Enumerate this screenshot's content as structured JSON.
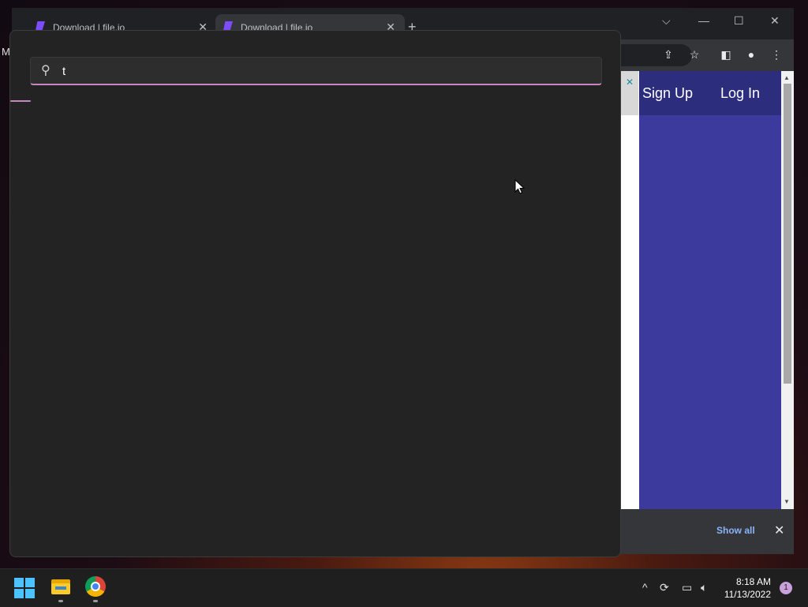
{
  "desktop": {
    "edge_text": "M"
  },
  "browser": {
    "tabs": [
      {
        "title": "Download | file.io",
        "close": "✕"
      },
      {
        "title": "Download | file.io",
        "close": "✕"
      }
    ],
    "new_tab": "+",
    "window_controls": {
      "dropdown": "⌵",
      "minimize": "—",
      "maximize": "☐",
      "close": "✕"
    },
    "page": {
      "sign_up": "Sign Up",
      "log_in": "Log In",
      "ad_close": "✕"
    },
    "downloads": {
      "show_all": "Show all",
      "close": "✕"
    }
  },
  "search": {
    "query": "t",
    "icon": "search-icon"
  },
  "taskbar": {
    "apps": [
      "start",
      "file-explorer",
      "chrome"
    ],
    "tray": {
      "chevron": "^"
    },
    "time": "8:18 AM",
    "date": "11/13/2022",
    "notification_count": "1"
  },
  "colors": {
    "accent": "#c886c0",
    "site_header": "#2c2d7c",
    "site_body": "#3d3a9e",
    "flyout_bg": "#232323"
  }
}
